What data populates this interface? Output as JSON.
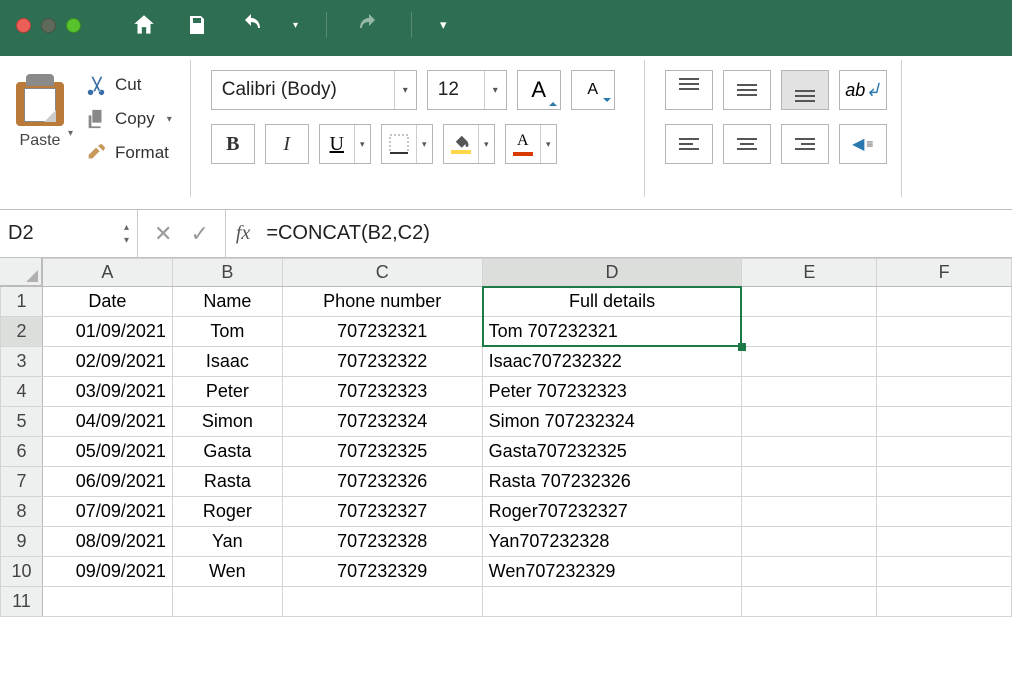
{
  "titlebar": {
    "window_controls": [
      "close",
      "minimize",
      "maximize"
    ]
  },
  "ribbon": {
    "paste_label": "Paste",
    "cut_label": "Cut",
    "copy_label": "Copy",
    "format_label": "Format",
    "font_name": "Calibri (Body)",
    "font_size": "12",
    "increase_font": "A",
    "decrease_font": "A",
    "bold": "B",
    "italic": "I",
    "underline": "U",
    "font_color_glyph": "A",
    "fill_color": "#ffd84a",
    "font_color": "#d83b01",
    "wrap_glyph": "ab"
  },
  "formula_bar": {
    "cell_ref": "D2",
    "fx_label": "fx",
    "formula": "=CONCAT(B2,C2)"
  },
  "grid": {
    "columns": [
      "A",
      "B",
      "C",
      "D",
      "E",
      "F"
    ],
    "selected_col": "D",
    "selected_row": 2,
    "headers": {
      "A": "Date",
      "B": "Name",
      "C": "Phone number",
      "D": "Full details"
    },
    "rows": [
      {
        "n": 1
      },
      {
        "n": 2,
        "A": "01/09/2021",
        "B": "Tom",
        "C": "707232321",
        "D": "Tom 707232321"
      },
      {
        "n": 3,
        "A": "02/09/2021",
        "B": "Isaac",
        "C": "707232322",
        "D": "Isaac707232322"
      },
      {
        "n": 4,
        "A": "03/09/2021",
        "B": "Peter",
        "C": "707232323",
        "D": "Peter 707232323"
      },
      {
        "n": 5,
        "A": "04/09/2021",
        "B": "Simon",
        "C": "707232324",
        "D": "Simon 707232324"
      },
      {
        "n": 6,
        "A": "05/09/2021",
        "B": "Gasta",
        "C": "707232325",
        "D": "Gasta707232325"
      },
      {
        "n": 7,
        "A": "06/09/2021",
        "B": "Rasta",
        "C": "707232326",
        "D": "Rasta 707232326"
      },
      {
        "n": 8,
        "A": "07/09/2021",
        "B": "Roger",
        "C": "707232327",
        "D": "Roger707232327"
      },
      {
        "n": 9,
        "A": "08/09/2021",
        "B": "Yan",
        "C": "707232328",
        "D": "Yan707232328"
      },
      {
        "n": 10,
        "A": "09/09/2021",
        "B": "Wen",
        "C": "707232329",
        "D": "Wen707232329"
      },
      {
        "n": 11
      }
    ]
  }
}
